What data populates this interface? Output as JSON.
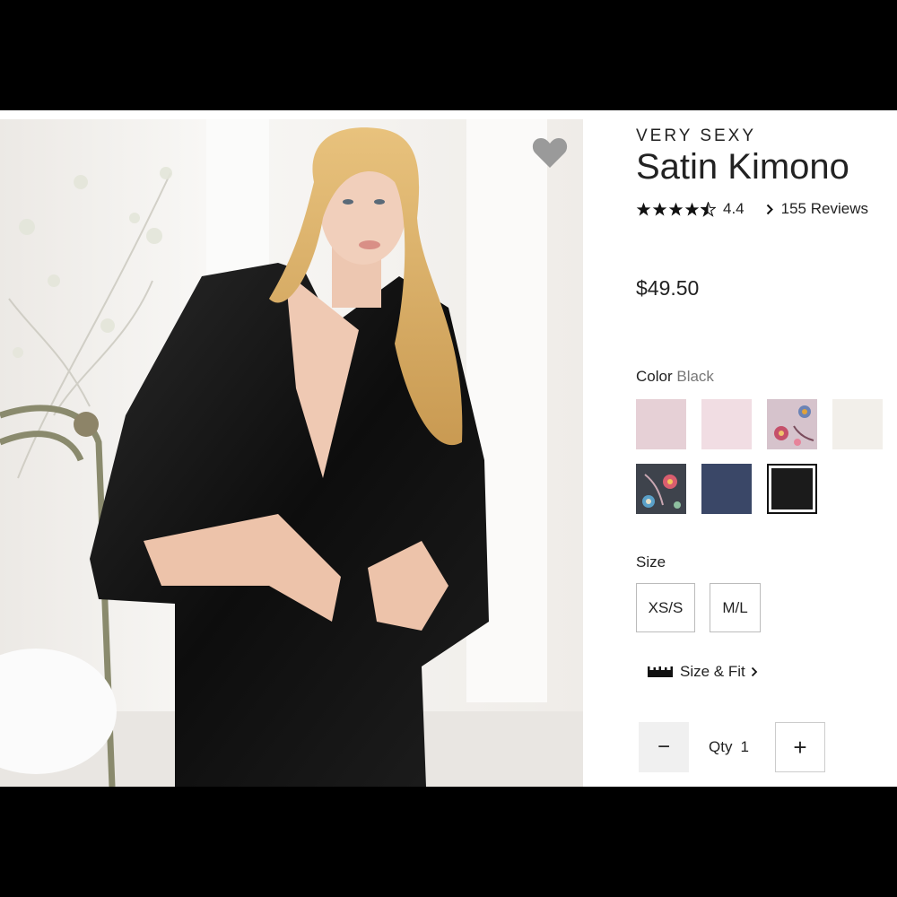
{
  "product": {
    "brand": "VERY SEXY",
    "title": "Satin Kimono",
    "rating": "4.4",
    "rating_stars": 4.5,
    "reviews_label": "155 Reviews",
    "price": "$49.50"
  },
  "color": {
    "label": "Color",
    "selected": "Black",
    "swatches": [
      {
        "name": "light-mauve",
        "color": "#e6d0d6"
      },
      {
        "name": "blush-pink",
        "color": "#f1dde3"
      },
      {
        "name": "floral-pink",
        "color": "#d6c3cc"
      },
      {
        "name": "ivory",
        "color": "#f2efea"
      },
      {
        "name": "floral-charcoal",
        "color": "#3e434c"
      },
      {
        "name": "navy",
        "color": "#3a4767"
      },
      {
        "name": "black",
        "color": "#1b1b1b"
      }
    ]
  },
  "size": {
    "label": "Size",
    "options": [
      "XS/S",
      "M/L"
    ],
    "size_fit_label": "Size & Fit"
  },
  "quantity": {
    "label": "Qty",
    "value": "1",
    "minus_symbol": "−",
    "plus_symbol": "+"
  },
  "icons": {
    "wishlist": "heart-icon",
    "rating": "star-icon",
    "reviews_link": "chevron-right-icon",
    "size_fit": "ruler-icon"
  }
}
